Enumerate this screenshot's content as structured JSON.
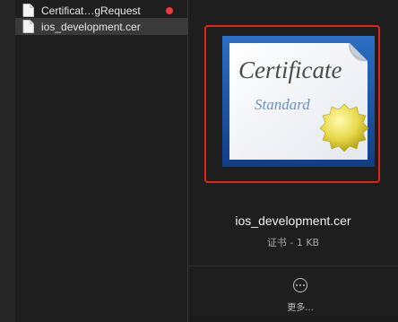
{
  "files": [
    {
      "name": "Certificat…gRequest",
      "tag_color": "#f0363f",
      "selected": false,
      "icon": "document-icon"
    },
    {
      "name": "ios_development.cer",
      "tag_color": "",
      "selected": true,
      "icon": "document-icon"
    }
  ],
  "preview": {
    "icon": "certificate-icon",
    "icon_text_main": "Certificate",
    "icon_text_sub": "Standard",
    "filename": "ios_development.cer",
    "kind_size": "证书 - 1 KB",
    "highlight_color": "#e0241c",
    "more_icon": "ellipsis-circle-icon",
    "more_label": "更多..."
  }
}
